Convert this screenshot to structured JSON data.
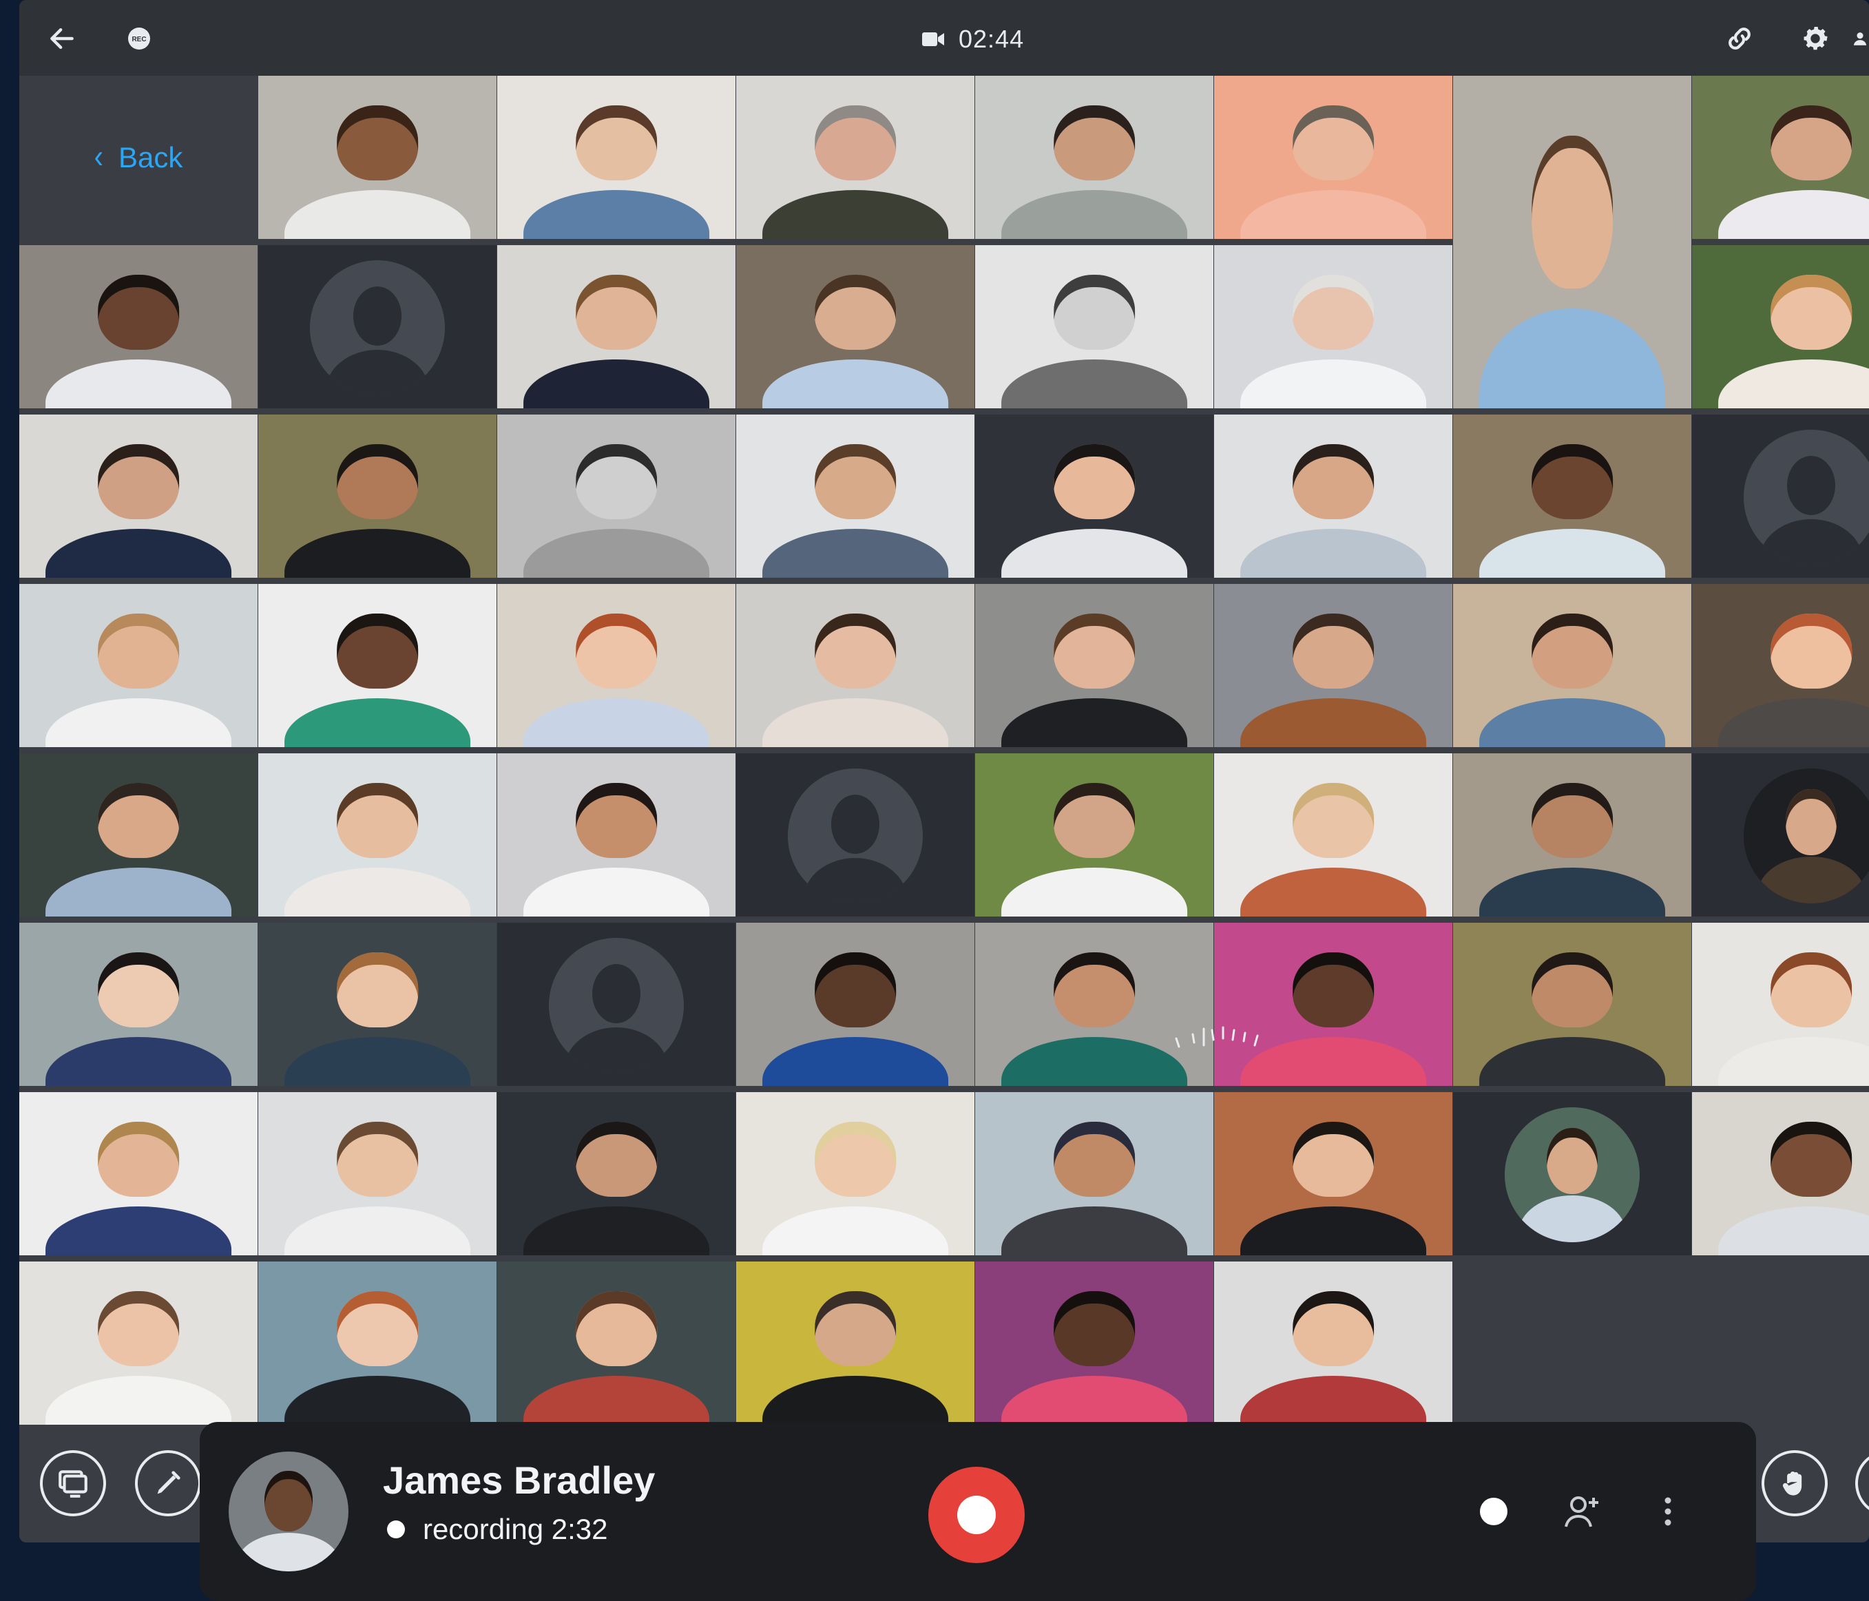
{
  "topbar": {
    "rec_badge": "REC",
    "timer": "02:44",
    "icons": {
      "back": "arrow-left-icon",
      "rec": "rec-icon",
      "camera": "video-camera-icon",
      "link": "link-icon",
      "settings": "gear-icon",
      "user": "user-icon"
    }
  },
  "grid": {
    "back_label": "Back",
    "tiles": [
      {
        "kind": "back"
      },
      {
        "kind": "photo",
        "bg": "#b9b6b0",
        "skin": "#8a5a3c",
        "hair": "#3a2418",
        "shirt": "#e9e9e7"
      },
      {
        "kind": "photo",
        "bg": "#e6e3df",
        "skin": "#e5bfa2",
        "hair": "#5a3b2a",
        "shirt": "#5c7fa8"
      },
      {
        "kind": "photo",
        "bg": "#d9d7d4",
        "skin": "#d8a892",
        "hair": "#8f8a86",
        "shirt": "#3b3f34"
      },
      {
        "kind": "photo",
        "bg": "#c9cbc8",
        "skin": "#c99a7b",
        "hair": "#2b211c",
        "shirt": "#9aa09c"
      },
      {
        "kind": "photo",
        "bg": "#f0a88c",
        "skin": "#e9b79c",
        "hair": "#6a6157",
        "shirt": "#f3b7a2"
      },
      {
        "kind": "photo",
        "span": true,
        "bg": "#b3aea6",
        "skin": "#e0b394",
        "hair": "#5a3e2a",
        "shirt": "#8fb6db"
      },
      {
        "kind": "photo",
        "bg": "#6b7a4e",
        "skin": "#d6a587",
        "hair": "#3b2419",
        "shirt": "#ece9ef"
      },
      {
        "kind": "photo",
        "bg": "#8b8780",
        "skin": "#6a4330",
        "hair": "#1a1410",
        "shirt": "#e8e9ec"
      },
      {
        "kind": "empty"
      },
      {
        "kind": "photo",
        "bg": "#d7d6d3",
        "skin": "#e0b496",
        "hair": "#7a5330",
        "shirt": "#1e2435"
      },
      {
        "kind": "photo",
        "bg": "#7a6e61",
        "skin": "#d9ad90",
        "hair": "#4a3424",
        "shirt": "#b8cde3"
      },
      {
        "kind": "photo",
        "bg": "#e4e4e4",
        "skin": "#d0d0d0",
        "hair": "#3e3e3e",
        "shirt": "#6e6e6e"
      },
      {
        "kind": "photo",
        "bg": "#d6d8dc",
        "skin": "#e8c3ad",
        "hair": "#e2e0dc",
        "shirt": "#f2f3f5"
      },
      {
        "kind": "photo",
        "bg": "#4f6b3c",
        "skin": "#ecc0a2",
        "hair": "#c58e52",
        "shirt": "#efe9e2"
      },
      {
        "kind": "photo",
        "bg": "#d9d8d5",
        "skin": "#cfa083",
        "hair": "#2b1f19",
        "shirt": "#1f2a44"
      },
      {
        "kind": "photo",
        "bg": "#7f7a54",
        "skin": "#b07a58",
        "hair": "#1b1714",
        "shirt": "#1c1d20"
      },
      {
        "kind": "photo",
        "bg": "#bdbdbd",
        "skin": "#cfcfcf",
        "hair": "#2c2c2c",
        "shirt": "#9b9b9b"
      },
      {
        "kind": "photo",
        "bg": "#e2e3e5",
        "skin": "#d7aa8a",
        "hair": "#5b3e2a",
        "shirt": "#55657c"
      },
      {
        "kind": "photo",
        "bg": "#2f3238",
        "skin": "#e7b99a",
        "hair": "#1a1616",
        "shirt": "#e4e5e8"
      },
      {
        "kind": "photo",
        "bg": "#dfe0e2",
        "skin": "#d7a787",
        "hair": "#2a201b",
        "shirt": "#b9c4cf"
      },
      {
        "kind": "photo",
        "bg": "#8a7a62",
        "skin": "#6b4530",
        "hair": "#191412",
        "shirt": "#d9e3ea"
      },
      {
        "kind": "empty"
      },
      {
        "kind": "photo",
        "bg": "#cfd4d6",
        "skin": "#e2b392",
        "hair": "#b8895a",
        "shirt": "#f1f1f1"
      },
      {
        "kind": "photo",
        "bg": "#ededed",
        "skin": "#6a4431",
        "hair": "#1b1612",
        "shirt": "#2c9a7a"
      },
      {
        "kind": "photo",
        "bg": "#d8d2c8",
        "skin": "#eec4a8",
        "hair": "#b0502a",
        "shirt": "#c8d3e6"
      },
      {
        "kind": "photo",
        "bg": "#cfcdc9",
        "skin": "#e5bca1",
        "hair": "#3a271b",
        "shirt": "#e6ddd7"
      },
      {
        "kind": "photo",
        "bg": "#8e8f8d",
        "skin": "#e2b59a",
        "hair": "#5b3d27",
        "shirt": "#1f2023"
      },
      {
        "kind": "photo",
        "bg": "#8a8e94",
        "skin": "#d8a88a",
        "hair": "#3a2a20",
        "shirt": "#9c5a32"
      },
      {
        "kind": "photo",
        "bg": "#c7b49a",
        "skin": "#d2a080",
        "hair": "#2b1f18",
        "shirt": "#5b7fa5"
      },
      {
        "kind": "photo",
        "bg": "#5b4d40",
        "skin": "#eec0a0",
        "hair": "#b85a33",
        "shirt": "#4e4a48"
      },
      {
        "kind": "photo",
        "bg": "#38433f",
        "skin": "#d8a888",
        "hair": "#2f2520",
        "shirt": "#9db3cc"
      },
      {
        "kind": "photo",
        "bg": "#dbe1e2",
        "skin": "#e6bd9f",
        "hair": "#5a3c27",
        "shirt": "#ece9e6"
      },
      {
        "kind": "photo",
        "bg": "#cfcfd2",
        "skin": "#c58f6b",
        "hair": "#1e1715",
        "shirt": "#f4f4f4"
      },
      {
        "kind": "empty"
      },
      {
        "kind": "photo",
        "bg": "#6f8a45",
        "skin": "#d2a588",
        "hair": "#2a1e18",
        "shirt": "#f2f2f2"
      },
      {
        "kind": "photo",
        "bg": "#e9e8e6",
        "skin": "#eac4a7",
        "hair": "#d0b07a",
        "shirt": "#c0623e"
      },
      {
        "kind": "photo",
        "bg": "#a39a8b",
        "skin": "#b68463",
        "hair": "#231b17",
        "shirt": "#2a3d4f"
      },
      {
        "kind": "circle",
        "bg": "#1d1f22",
        "skin": "#d7a889",
        "hair": "#3b2a1f",
        "shirt": "#4a3b2f"
      },
      {
        "kind": "photo",
        "bg": "#9aa6a8",
        "skin": "#edcbb2",
        "hair": "#1b1616",
        "shirt": "#2c3c6a"
      },
      {
        "kind": "photo",
        "bg": "#3c464a",
        "skin": "#eac3a7",
        "hair": "#a36a3c",
        "shirt": "#2b3f52"
      },
      {
        "kind": "empty"
      },
      {
        "kind": "photo",
        "bg": "#9b9a96",
        "skin": "#5a3a28",
        "hair": "#15100e",
        "shirt": "#1f4c9a"
      },
      {
        "kind": "photo",
        "bg": "#a3a29e",
        "skin": "#c58f6e",
        "hair": "#1a1412",
        "shirt": "#1c6d63"
      },
      {
        "kind": "photo",
        "bg": "#c24a8c",
        "skin": "#5e3b2a",
        "hair": "#14100d",
        "shirt": "#e24b72"
      },
      {
        "kind": "photo",
        "bg": "#8f8455",
        "skin": "#bf8a68",
        "hair": "#211915",
        "shirt": "#2d3035"
      },
      {
        "kind": "photo",
        "bg": "#e6e5e2",
        "skin": "#ecc2a5",
        "hair": "#8a4a2a",
        "shirt": "#ecebe7"
      },
      {
        "kind": "photo",
        "bg": "#ededee",
        "skin": "#e3b596",
        "hair": "#b0864f",
        "shirt": "#2d3e74"
      },
      {
        "kind": "photo",
        "bg": "#dcdedf",
        "skin": "#e8c0a2",
        "hair": "#6b4a33",
        "shirt": "#efefef"
      },
      {
        "kind": "photo",
        "bg": "#2d3239",
        "skin": "#c99878",
        "hair": "#1b1716",
        "shirt": "#1e2024"
      },
      {
        "kind": "photo",
        "bg": "#e7e3dd",
        "skin": "#eec8ab",
        "hair": "#e2cf9e",
        "shirt": "#f4f4f4"
      },
      {
        "kind": "photo",
        "bg": "#b7c3cb",
        "skin": "#c08a66",
        "hair": "#2a2b3c",
        "shirt": "#3b3d42"
      },
      {
        "kind": "photo",
        "bg": "#b36b45",
        "skin": "#e6ba9b",
        "hair": "#1d1714",
        "shirt": "#1b1c20"
      },
      {
        "kind": "circle",
        "bg": "#506b5e",
        "skin": "#d8aa8a",
        "hair": "#2a1e16",
        "shirt": "#cad7e3"
      },
      {
        "kind": "photo",
        "bg": "#d8d6cf",
        "skin": "#7a4e36",
        "hair": "#1a1410",
        "shirt": "#dcdfe4"
      },
      {
        "kind": "photo",
        "bg": "#e3e1dd",
        "skin": "#ecc3a6",
        "hair": "#6a4a33",
        "shirt": "#f3f3f1"
      },
      {
        "kind": "photo",
        "bg": "#7a98a6",
        "skin": "#eec8ae",
        "hair": "#b55d33",
        "shirt": "#1f2328"
      },
      {
        "kind": "photo",
        "bg": "#3f4a4c",
        "skin": "#e6b99b",
        "hair": "#5b3a27",
        "shirt": "#b4433a"
      },
      {
        "kind": "photo",
        "bg": "#c9b63c",
        "skin": "#d6a88a",
        "hair": "#3a2e28",
        "shirt": "#1a1b1d"
      },
      {
        "kind": "photo",
        "bg": "#8a3f7a",
        "skin": "#5a3827",
        "hair": "#15100d",
        "shirt": "#e24b72"
      },
      {
        "kind": "photo",
        "bg": "#dcdcdc",
        "skin": "#e8bd9d",
        "hair": "#1c1715",
        "shirt": "#b23a3a"
      }
    ]
  },
  "controls": {
    "left": [
      {
        "name": "screen-share-button",
        "icon": "screen-share-icon"
      },
      {
        "name": "annotate-button",
        "icon": "pen-icon"
      }
    ],
    "right": [
      {
        "name": "raise-hand-button",
        "icon": "hand-icon"
      },
      {
        "name": "chat-button",
        "icon": "chat-icon"
      }
    ]
  },
  "recording_bar": {
    "name": "James Bradley",
    "status": "recording 2:32",
    "icons": {
      "record": "record-icon",
      "dot": "dot-icon",
      "add_user": "add-user-icon",
      "more": "more-vertical-icon"
    }
  },
  "colors": {
    "background": "#0d1b33",
    "app": "#3a3e44",
    "topbar": "#2f3237",
    "accent": "#2aa6f5",
    "record": "#e5403a",
    "bar": "#1b1d20"
  }
}
